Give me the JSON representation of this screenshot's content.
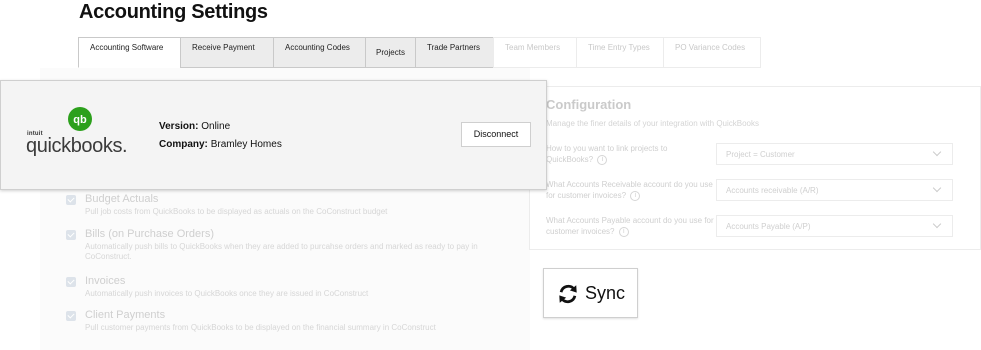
{
  "page": {
    "title": "Accounting Settings"
  },
  "tabs": [
    {
      "label": "Accounting Software",
      "state": "active"
    },
    {
      "label": "Receive Payment",
      "state": "normal"
    },
    {
      "label": "Accounting Codes",
      "state": "normal"
    },
    {
      "label": "Projects",
      "state": "normal"
    },
    {
      "label": "Trade Partners",
      "state": "normal"
    },
    {
      "label": "Team Members",
      "state": "disabled"
    },
    {
      "label": "Time Entry Types",
      "state": "disabled"
    },
    {
      "label": "PO Variance Codes",
      "state": "disabled"
    }
  ],
  "integration": {
    "logo_small_text": "intuit",
    "logo_wordmark": "quickbooks.",
    "logo_badge": "qb",
    "version_label": "Version:",
    "version_value": "Online",
    "company_label": "Company:",
    "company_value": "Bramley Homes",
    "disconnect_label": "Disconnect"
  },
  "sync_options": [
    {
      "title": "Budget Actuals",
      "description": "Pull job costs from QuickBooks to be displayed as actuals on the CoConstruct budget",
      "checked": true
    },
    {
      "title": "Bills (on Purchase Orders)",
      "description": "Automatically push bills to QuickBooks when they are added to purcahse orders and marked as ready to pay in CoConstruct.",
      "checked": true
    },
    {
      "title": "Invoices",
      "description": "Automatically push invoices to QuickBooks once they are issued in CoConstruct",
      "checked": true
    },
    {
      "title": "Client Payments",
      "description": "Pull customer payments from QuickBooks to be displayed on the financial summary in CoConstruct",
      "checked": true
    }
  ],
  "configuration": {
    "title": "Configuration",
    "subtitle": "Manage the finer details of your integration with QuickBooks",
    "questions": [
      {
        "label": "How to you want to link projects to QuickBooks?",
        "value": "Project = Customer"
      },
      {
        "label": "What Accounts Receivable account do you use for customer invoices?",
        "value": "Accounts receivable (A/R)"
      },
      {
        "label": "What Accounts Payable account do you use for customer invoices?",
        "value": "Accounts Payable (A/P)"
      }
    ],
    "info_glyph": "i"
  },
  "sync_button": {
    "label": "Sync"
  },
  "colors": {
    "qb_green": "#2ca01c",
    "panel_bg": "#f4f4f4",
    "border": "#cfcfcf"
  }
}
